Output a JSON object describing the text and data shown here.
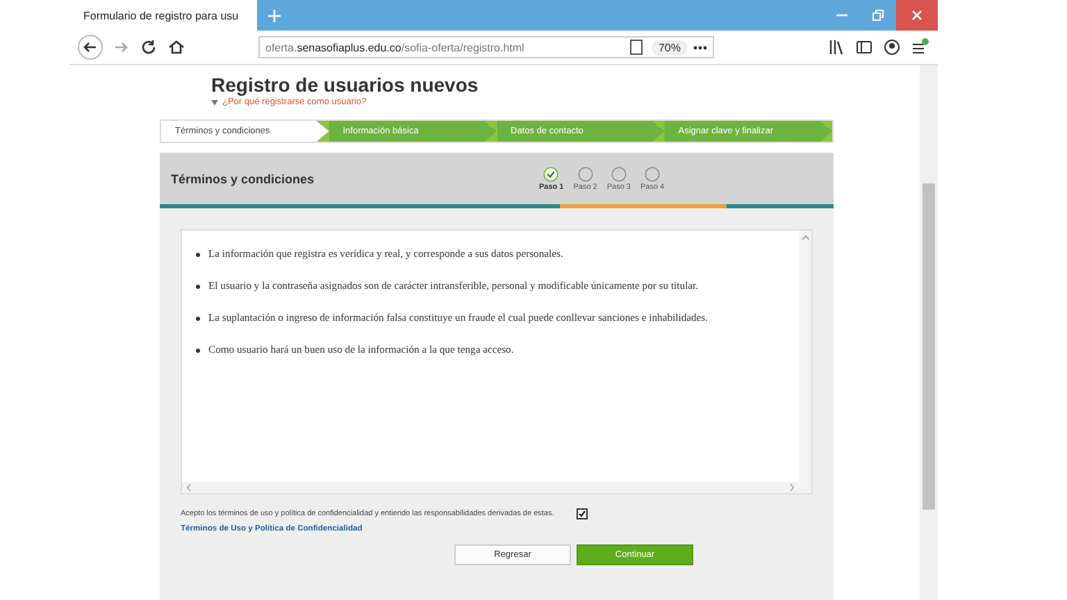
{
  "browser": {
    "tab_title": "Formulario de registro para usu",
    "url_prefix": "oferta.",
    "url_domain": "senasofiaplus.edu.co",
    "url_path": "/sofia-oferta/registro.html",
    "zoom": "70%"
  },
  "page": {
    "title": "Registro de usuarios nuevos",
    "help_link": "¿Por qué registrarse como usuario?"
  },
  "wizard": [
    {
      "label": "Términos y condiciones",
      "selected": true
    },
    {
      "label": "Información básica",
      "selected": false
    },
    {
      "label": "Datos de contacto",
      "selected": false
    },
    {
      "label": "Asignar clave y finalizar",
      "selected": false
    }
  ],
  "panel": {
    "title": "Términos y condiciones",
    "steps": [
      {
        "label": "Paso 1",
        "done": true
      },
      {
        "label": "Paso 2",
        "done": false
      },
      {
        "label": "Paso 3",
        "done": false
      },
      {
        "label": "Paso 4",
        "done": false
      }
    ],
    "terms": [
      "La información que registra es verídica y real, y corresponde a sus datos personales.",
      "El usuario y la contraseña asignados son de carácter intransferible, personal y modificable únicamente por su titular.",
      "La suplantación o ingreso de información falsa constituye un fraude el cual puede conllevar sanciones e inhabilidades.",
      "Como usuario hará un buen uso de la información a la que tenga acceso."
    ],
    "accept": {
      "label": "Acepto los términos de uso y política de confidencialidad y entiendo las responsabilidades derivadas de estas.",
      "checked": true
    },
    "policy_link": "Términos de Uso y Política de Confidencialidad",
    "buttons": [
      {
        "label": "Regresar",
        "kind": "secondary"
      },
      {
        "label": "Continuar",
        "kind": "primary"
      }
    ]
  }
}
